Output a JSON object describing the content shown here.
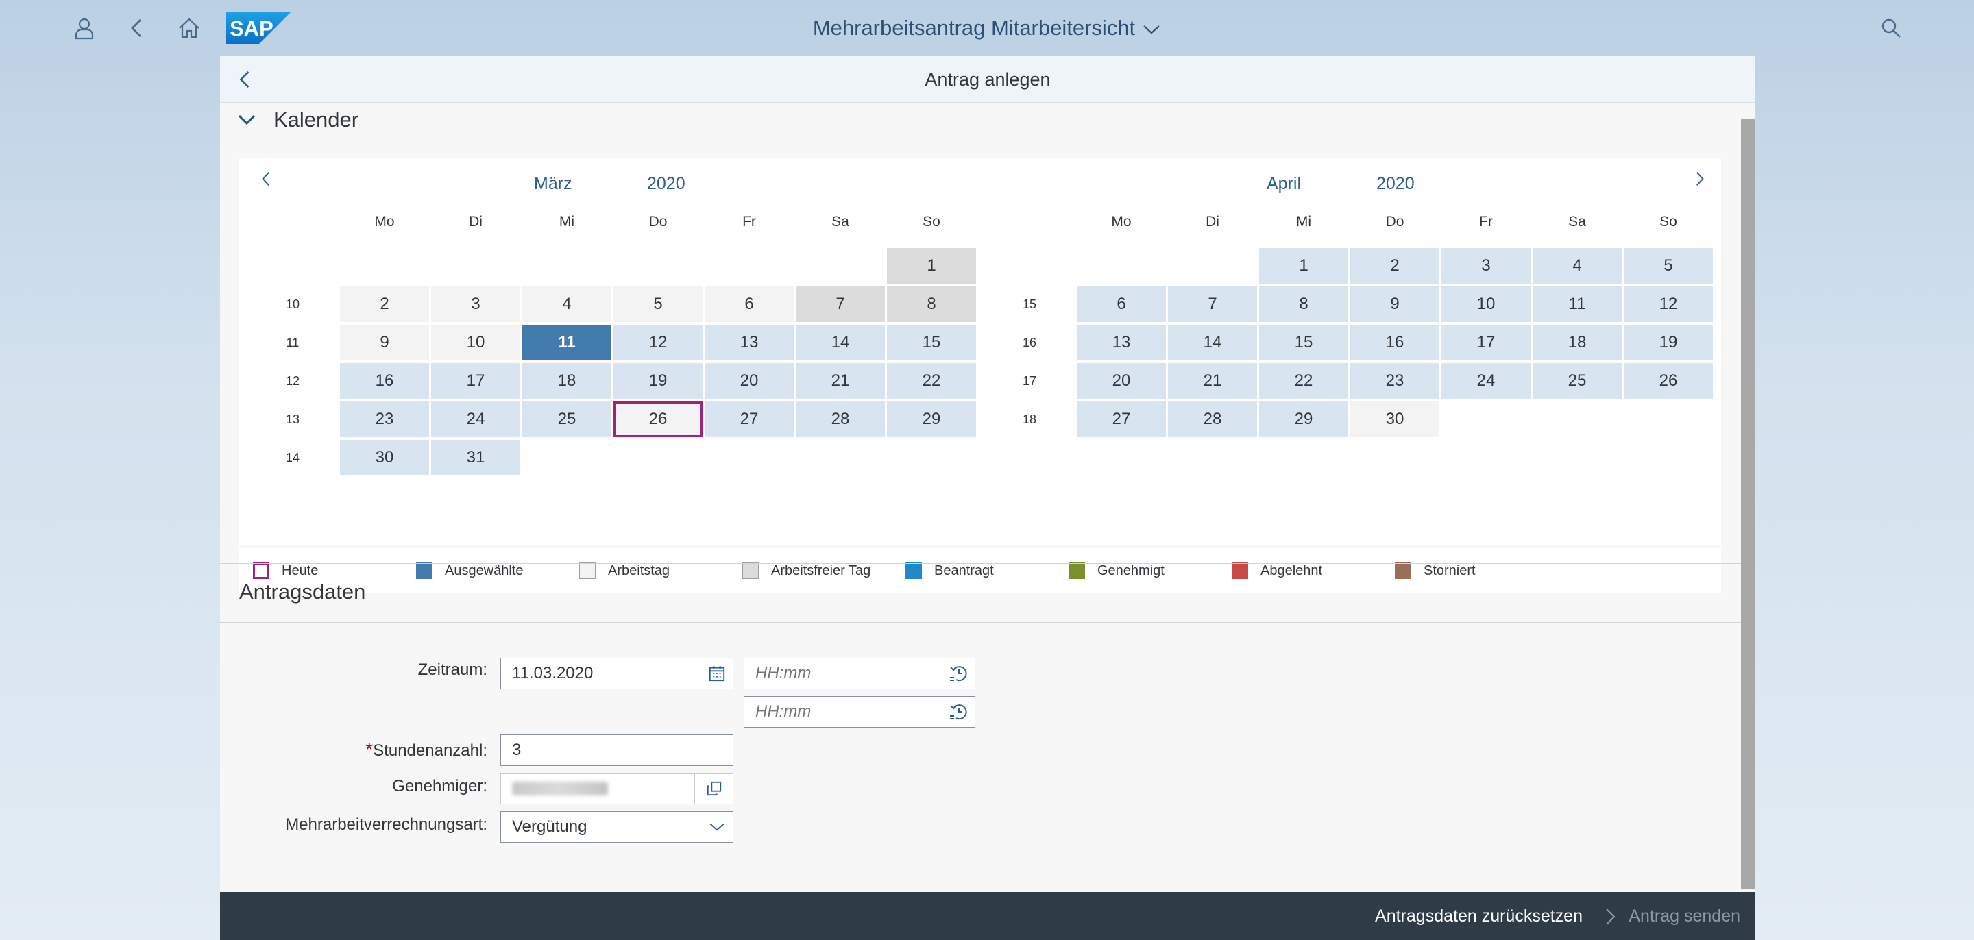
{
  "shell": {
    "title": "Mehrarbeitsantrag Mitarbeitersicht",
    "icons": [
      "person-icon",
      "back-icon",
      "home-icon",
      "search-icon"
    ],
    "logo_text": "SAP"
  },
  "page": {
    "title": "Antrag anlegen"
  },
  "calendar": {
    "section_title": "Kalender",
    "weekdays": [
      "Mo",
      "Di",
      "Mi",
      "Do",
      "Fr",
      "Sa",
      "So"
    ],
    "months": [
      {
        "month": "März",
        "year": "2020",
        "weeks": [
          "10",
          "11",
          "12",
          "13",
          "14"
        ],
        "days": [
          {
            "d": "1",
            "row": 0,
            "col": 6,
            "type": "off"
          },
          {
            "d": "2",
            "row": 1,
            "col": 0,
            "type": "work"
          },
          {
            "d": "3",
            "row": 1,
            "col": 1,
            "type": "work"
          },
          {
            "d": "4",
            "row": 1,
            "col": 2,
            "type": "work"
          },
          {
            "d": "5",
            "row": 1,
            "col": 3,
            "type": "work"
          },
          {
            "d": "6",
            "row": 1,
            "col": 4,
            "type": "work"
          },
          {
            "d": "7",
            "row": 1,
            "col": 5,
            "type": "off"
          },
          {
            "d": "8",
            "row": 1,
            "col": 6,
            "type": "off"
          },
          {
            "d": "9",
            "row": 2,
            "col": 0,
            "type": "work"
          },
          {
            "d": "10",
            "row": 2,
            "col": 1,
            "type": "work"
          },
          {
            "d": "11",
            "row": 2,
            "col": 2,
            "type": "selected"
          },
          {
            "d": "12",
            "row": 2,
            "col": 3,
            "type": "req"
          },
          {
            "d": "13",
            "row": 2,
            "col": 4,
            "type": "req"
          },
          {
            "d": "14",
            "row": 2,
            "col": 5,
            "type": "req"
          },
          {
            "d": "15",
            "row": 2,
            "col": 6,
            "type": "req"
          },
          {
            "d": "16",
            "row": 3,
            "col": 0,
            "type": "req"
          },
          {
            "d": "17",
            "row": 3,
            "col": 1,
            "type": "req"
          },
          {
            "d": "18",
            "row": 3,
            "col": 2,
            "type": "req"
          },
          {
            "d": "19",
            "row": 3,
            "col": 3,
            "type": "req"
          },
          {
            "d": "20",
            "row": 3,
            "col": 4,
            "type": "req"
          },
          {
            "d": "21",
            "row": 3,
            "col": 5,
            "type": "req"
          },
          {
            "d": "22",
            "row": 3,
            "col": 6,
            "type": "req"
          },
          {
            "d": "23",
            "row": 4,
            "col": 0,
            "type": "req"
          },
          {
            "d": "24",
            "row": 4,
            "col": 1,
            "type": "req"
          },
          {
            "d": "25",
            "row": 4,
            "col": 2,
            "type": "req"
          },
          {
            "d": "26",
            "row": 4,
            "col": 3,
            "type": "today"
          },
          {
            "d": "27",
            "row": 4,
            "col": 4,
            "type": "req"
          },
          {
            "d": "28",
            "row": 4,
            "col": 5,
            "type": "req"
          },
          {
            "d": "29",
            "row": 4,
            "col": 6,
            "type": "req"
          },
          {
            "d": "30",
            "row": 5,
            "col": 0,
            "type": "req"
          },
          {
            "d": "31",
            "row": 5,
            "col": 1,
            "type": "req"
          }
        ]
      },
      {
        "month": "April",
        "year": "2020",
        "weeks": [
          "15",
          "16",
          "17",
          "18"
        ],
        "days": [
          {
            "d": "1",
            "row": 0,
            "col": 2,
            "type": "req"
          },
          {
            "d": "2",
            "row": 0,
            "col": 3,
            "type": "req"
          },
          {
            "d": "3",
            "row": 0,
            "col": 4,
            "type": "req"
          },
          {
            "d": "4",
            "row": 0,
            "col": 5,
            "type": "req"
          },
          {
            "d": "5",
            "row": 0,
            "col": 6,
            "type": "req"
          },
          {
            "d": "6",
            "row": 1,
            "col": 0,
            "type": "req"
          },
          {
            "d": "7",
            "row": 1,
            "col": 1,
            "type": "req"
          },
          {
            "d": "8",
            "row": 1,
            "col": 2,
            "type": "req"
          },
          {
            "d": "9",
            "row": 1,
            "col": 3,
            "type": "req"
          },
          {
            "d": "10",
            "row": 1,
            "col": 4,
            "type": "req"
          },
          {
            "d": "11",
            "row": 1,
            "col": 5,
            "type": "req"
          },
          {
            "d": "12",
            "row": 1,
            "col": 6,
            "type": "req"
          },
          {
            "d": "13",
            "row": 2,
            "col": 0,
            "type": "req"
          },
          {
            "d": "14",
            "row": 2,
            "col": 1,
            "type": "req"
          },
          {
            "d": "15",
            "row": 2,
            "col": 2,
            "type": "req"
          },
          {
            "d": "16",
            "row": 2,
            "col": 3,
            "type": "req"
          },
          {
            "d": "17",
            "row": 2,
            "col": 4,
            "type": "req"
          },
          {
            "d": "18",
            "row": 2,
            "col": 5,
            "type": "req"
          },
          {
            "d": "19",
            "row": 2,
            "col": 6,
            "type": "req"
          },
          {
            "d": "20",
            "row": 3,
            "col": 0,
            "type": "req"
          },
          {
            "d": "21",
            "row": 3,
            "col": 1,
            "type": "req"
          },
          {
            "d": "22",
            "row": 3,
            "col": 2,
            "type": "req"
          },
          {
            "d": "23",
            "row": 3,
            "col": 3,
            "type": "req"
          },
          {
            "d": "24",
            "row": 3,
            "col": 4,
            "type": "req"
          },
          {
            "d": "25",
            "row": 3,
            "col": 5,
            "type": "req"
          },
          {
            "d": "26",
            "row": 3,
            "col": 6,
            "type": "req"
          },
          {
            "d": "27",
            "row": 4,
            "col": 0,
            "type": "req"
          },
          {
            "d": "28",
            "row": 4,
            "col": 1,
            "type": "req"
          },
          {
            "d": "29",
            "row": 4,
            "col": 2,
            "type": "req"
          },
          {
            "d": "30",
            "row": 4,
            "col": 3,
            "type": "work"
          }
        ]
      }
    ],
    "legend": [
      {
        "label": "Heute",
        "kind": "outline",
        "color": "#a2217a"
      },
      {
        "label": "Ausgewählte",
        "kind": "fill",
        "color": "#427cac"
      },
      {
        "label": "Arbeitstag",
        "kind": "outline-grey",
        "color": "#f3f3f3"
      },
      {
        "label": "Arbeitsfreier Tag",
        "kind": "fill-grey",
        "color": "#dcdcdc"
      },
      {
        "label": "Beantragt",
        "kind": "fill",
        "color": "#2289c9"
      },
      {
        "label": "Genehmigt",
        "kind": "fill",
        "color": "#7b912d"
      },
      {
        "label": "Abgelehnt",
        "kind": "fill",
        "color": "#c94848"
      },
      {
        "label": "Storniert",
        "kind": "fill",
        "color": "#9a6f5a"
      }
    ]
  },
  "form": {
    "section_title": "Antragsdaten",
    "zeitraum_label": "Zeitraum:",
    "zeitraum_value": "11.03.2020",
    "time_placeholder": "HH:mm",
    "stunden_required": "*",
    "stunden_label": "Stundenanzahl:",
    "stunden_value": "3",
    "genehmiger_label": "Genehmiger:",
    "verrechnung_label": "Mehrarbeitverrechnungsart:",
    "verrechnung_value": "Vergütung"
  },
  "footer": {
    "reset_label": "Antragsdaten zurücksetzen",
    "send_label": "Antrag senden"
  }
}
